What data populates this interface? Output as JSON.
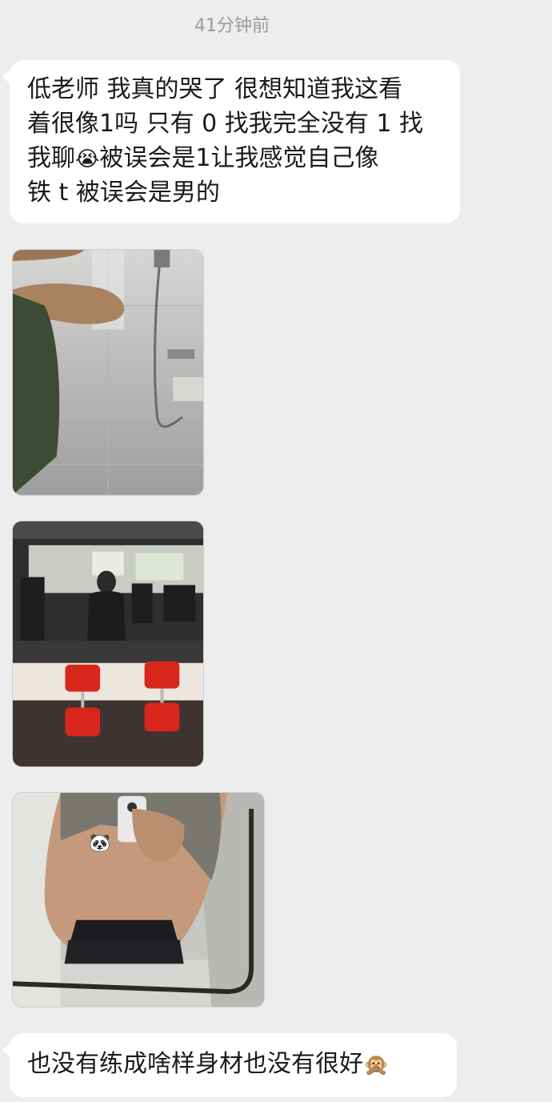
{
  "timestamp": "41分钟前",
  "messages": [
    {
      "type": "text",
      "line1": "低老师 我真的哭了 很想知道我这看",
      "line2": "着很像1吗 只有 0 找我完全没有 1 找",
      "line3_before": "我聊",
      "line3_emoji": "😭",
      "line3_after": "被误会是1让我感觉自己像",
      "line4": "铁 t 被误会是男的"
    },
    {
      "type": "text",
      "text_before": "也没有练成啥样身材也没有很好",
      "emoji": "🙊"
    }
  ],
  "images": [
    {
      "name": "bathroom-arm-photo"
    },
    {
      "name": "gym-dumbbell-photo"
    },
    {
      "name": "mirror-selfie-photo",
      "overlay_emoji": "🐼"
    }
  ],
  "colors": {
    "background": "#ededed",
    "bubble": "#ffffff",
    "text": "#1a1a1a",
    "timestamp": "#9a9a9a"
  }
}
